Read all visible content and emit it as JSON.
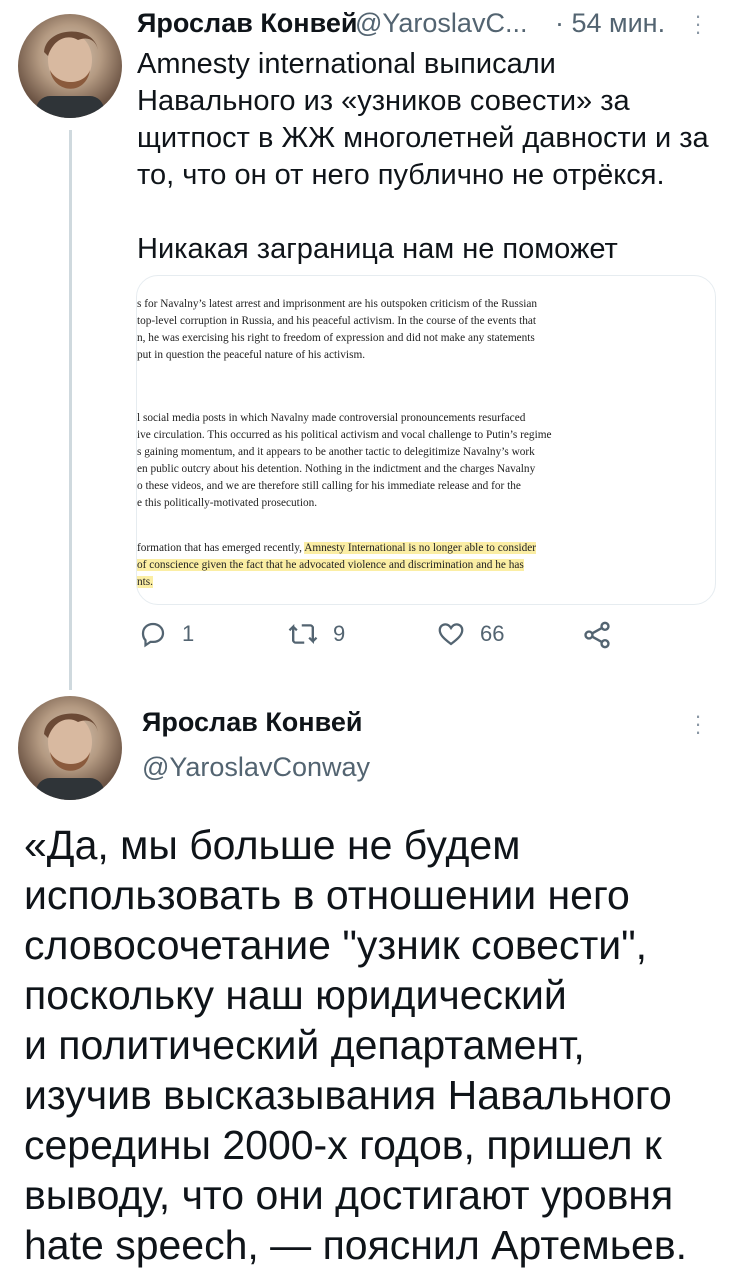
{
  "tweet1": {
    "name": "Ярослав Конвей",
    "handle": "@YaroslavC...",
    "time": "· 54 мин.",
    "text_lines": [
      "Amnesty international выписали",
      "Навального из «узников совести» за",
      "щитпост в ЖЖ многолетней давности и за",
      "то, что он от него публично не отрёкся."
    ],
    "text_line2": "Никакая заграница нам не поможет",
    "media": {
      "paragraphs": [
        [
          "s for Navalny’s latest arrest and imprisonment are his outspoken criticism of the Russian",
          "top-level corruption in Russia, and his peaceful activism. In the course of the events that",
          "n, he was exercising his right to freedom of expression and did not make any statements",
          "put in question the peaceful nature of his activism."
        ],
        [
          "l social media posts in which Navalny made controversial pronouncements resurfaced",
          "ive circulation. This occurred as his political activism and vocal challenge to Putin’s regime",
          "s gaining momentum, and it appears to be another tactic to delegitimize Navalny’s work",
          "en public outcry about his detention. Nothing in the indictment and the charges Navalny",
          "o these videos, and we are therefore still calling for his immediate release and for the",
          "e this politically-motivated prosecution."
        ]
      ],
      "hl_p1_normal": "formation that has emerged recently, ",
      "hl_p1_highlight": "Amnesty International is no longer able to consider",
      "hl_p2": "of conscience given the fact that he advocated violence and discrimination and he has",
      "hl_p3": "nts."
    },
    "actions": {
      "reply_count": "1",
      "retweet_count": "9",
      "like_count": "66"
    }
  },
  "tweet2": {
    "name": "Ярослав Конвей",
    "handle": "@YaroslavConway",
    "text_lines": [
      "«Да, мы больше не будем",
      "использовать в отношении него",
      "словосочетание \"узник совести\",",
      "поскольку наш юридический",
      "и политический департамент,",
      "изучив высказывания Навального",
      "середины 2000-х годов, пришел к",
      "выводу, что они достигают уровня",
      "hate speech, — пояснил Артемьев."
    ]
  },
  "colors": {
    "text": "#0f1419",
    "muted": "#536471",
    "highlight": "#fbeea4",
    "thread_line": "#cfd9de"
  }
}
